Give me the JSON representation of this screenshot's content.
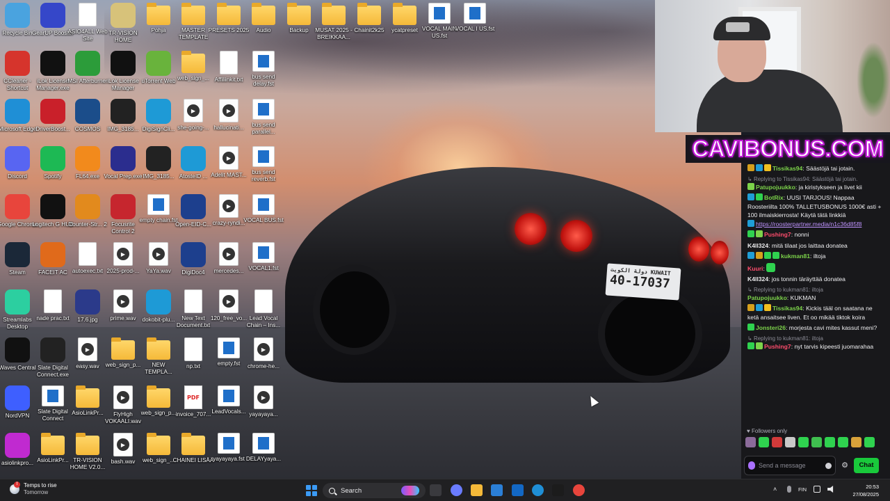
{
  "desktop": {
    "icons": [
      {
        "label": "Recycle Bin",
        "icon": "recycle-bin-icon",
        "kind": "app",
        "color": "#4aa3df"
      },
      {
        "label": "GearUP Booster",
        "icon": "gearup-icon",
        "kind": "app",
        "color": "#3547c9"
      },
      {
        "label": "ASIO4ALL Web Site",
        "icon": "document-icon",
        "kind": "doc"
      },
      {
        "label": "TR-VISION HOME",
        "icon": "tr-vision-icon",
        "kind": "app",
        "color": "#d7c27a"
      },
      {
        "label": "Pohja",
        "icon": "folder-icon",
        "kind": "folder"
      },
      {
        "label": "MASTER TEMPLATE",
        "icon": "folder-icon",
        "kind": "folder"
      },
      {
        "label": "PRESETS 2025",
        "icon": "folder-icon",
        "kind": "folder"
      },
      {
        "label": "Audio",
        "icon": "folder-icon",
        "kind": "folder"
      },
      {
        "label": "Backup",
        "icon": "folder-icon",
        "kind": "folder"
      },
      {
        "label": "MUSAT 2025 - BREIKKAA...",
        "icon": "folder-icon",
        "kind": "folder"
      },
      {
        "label": "Chainit2k25",
        "icon": "folder-icon",
        "kind": "folder"
      },
      {
        "label": "ycatpreset",
        "icon": "folder-icon",
        "kind": "folder"
      },
      {
        "label": "VOCAL MAIN US.fst",
        "icon": "fst-file-icon",
        "kind": "fst"
      },
      {
        "label": "VOCAL I US.fst",
        "icon": "fst-file-icon",
        "kind": "fst"
      },
      {
        "label": "CCleaner - Shortcut",
        "icon": "ccleaner-icon",
        "kind": "app",
        "color": "#d6342c"
      },
      {
        "label": "iLok License Manager.exe",
        "icon": "ilok-icon",
        "kind": "app",
        "color": "#111111"
      },
      {
        "label": "MSI Afterburner",
        "icon": "msi-afterburner-icon",
        "kind": "app",
        "color": "#2c9c3a"
      },
      {
        "label": "iLok License Manager",
        "icon": "ilok-icon",
        "kind": "app",
        "color": "#111111"
      },
      {
        "label": "uTorrent Web",
        "icon": "utorrent-icon",
        "kind": "app",
        "color": "#69b33c"
      },
      {
        "label": "web_sign_...",
        "icon": "folder-icon",
        "kind": "folder"
      },
      {
        "label": "Affiliinkit.txt",
        "icon": "text-file-icon",
        "kind": "doc"
      },
      {
        "label": "bus send delay.fst",
        "icon": "fst-file-icon",
        "kind": "fst"
      },
      {
        "label": "Microsoft Edge",
        "icon": "edge-icon",
        "kind": "app",
        "color": "#1f8fd6"
      },
      {
        "label": "DriverBoost...",
        "icon": "driver-booster-icon",
        "kind": "app",
        "color": "#c9202a"
      },
      {
        "label": "COSMOS",
        "icon": "cosmos-icon",
        "kind": "app",
        "color": "#1b4d8a"
      },
      {
        "label": "IMG_3185...",
        "icon": "image-file-icon",
        "kind": "app",
        "color": "#222222"
      },
      {
        "label": "DigiSignCli...",
        "icon": "digisign-icon",
        "kind": "app",
        "color": "#1e9ad6"
      },
      {
        "label": "she-going-...",
        "icon": "audio-file-icon",
        "kind": "wav"
      },
      {
        "label": "hallucinati...",
        "icon": "audio-file-icon",
        "kind": "wav"
      },
      {
        "label": "bus send parallel...",
        "icon": "fst-file-icon",
        "kind": "fst"
      },
      {
        "label": "Discord",
        "icon": "discord-icon",
        "kind": "app",
        "color": "#5865f2"
      },
      {
        "label": "Spotify",
        "icon": "spotify-icon",
        "kind": "app",
        "color": "#1db954"
      },
      {
        "label": "FL64.exe",
        "icon": "fl-studio-icon",
        "kind": "app",
        "color": "#f28a1c"
      },
      {
        "label": "Vocal Prep.exe",
        "icon": "vocal-prep-icon",
        "kind": "app",
        "color": "#2b2d8e"
      },
      {
        "label": "IMG_3185...",
        "icon": "image-file-icon",
        "kind": "app",
        "color": "#222222"
      },
      {
        "label": "AtosteID ...",
        "icon": "atoste-id-icon",
        "kind": "app",
        "color": "#1e9ad6"
      },
      {
        "label": "Adelit MAST...",
        "icon": "audio-file-icon",
        "kind": "wav"
      },
      {
        "label": "bus send reverb.fst",
        "icon": "fst-file-icon",
        "kind": "fst"
      },
      {
        "label": "Google Chrome",
        "icon": "chrome-icon",
        "kind": "app",
        "color": "#e8453c"
      },
      {
        "label": "Logitech G HUB",
        "icon": "logitech-icon",
        "kind": "app",
        "color": "#111111"
      },
      {
        "label": "Counter-Str... 2",
        "icon": "counter-strike-icon",
        "kind": "app",
        "color": "#e28a1d"
      },
      {
        "label": "Focusrite Control 2",
        "icon": "focusrite-icon",
        "kind": "app",
        "color": "#c6262e"
      },
      {
        "label": "empty chain.fst",
        "icon": "fst-file-icon",
        "kind": "fst"
      },
      {
        "label": "Open-EID-C...",
        "icon": "open-eid-icon",
        "kind": "app",
        "color": "#1d3f8d"
      },
      {
        "label": "crazy-ryndi...",
        "icon": "audio-file-icon",
        "kind": "wav"
      },
      {
        "label": "VOCAL BUS.fst",
        "icon": "fst-file-icon",
        "kind": "fst"
      },
      {
        "label": "Steam",
        "icon": "steam-icon",
        "kind": "app",
        "color": "#1b2838"
      },
      {
        "label": "FACEIT AC",
        "icon": "faceit-icon",
        "kind": "app",
        "color": "#e06a1b"
      },
      {
        "label": "autoexec.txt",
        "icon": "text-file-icon",
        "kind": "doc"
      },
      {
        "label": "2025-prod-...",
        "icon": "audio-file-icon",
        "kind": "wav"
      },
      {
        "label": "YaYa.wav",
        "icon": "audio-file-icon",
        "kind": "wav"
      },
      {
        "label": "DigiDoc4",
        "icon": "digidoc-icon",
        "kind": "app",
        "color": "#1d3f8d"
      },
      {
        "label": "mercedes...",
        "icon": "audio-file-icon",
        "kind": "wav"
      },
      {
        "label": "VOCAL1.fst",
        "icon": "fst-file-icon",
        "kind": "fst"
      },
      {
        "label": "Streamlabs Desktop",
        "icon": "streamlabs-icon",
        "kind": "app",
        "color": "#2ccfa0"
      },
      {
        "label": "nade prac.txt",
        "icon": "text-file-icon",
        "kind": "doc"
      },
      {
        "label": "17.6.jpg",
        "icon": "image-file-icon",
        "kind": "app",
        "color": "#2b3a8a"
      },
      {
        "label": "prime.wav",
        "icon": "audio-file-icon",
        "kind": "wav"
      },
      {
        "label": "dokobit-plu...",
        "icon": "dokobit-icon",
        "kind": "app",
        "color": "#1e9ad6"
      },
      {
        "label": "New Text Document.txt",
        "icon": "text-file-icon",
        "kind": "doc"
      },
      {
        "label": "120_free_vo...",
        "icon": "audio-file-icon",
        "kind": "wav"
      },
      {
        "label": "Lead Vocal Chain – Ins...",
        "icon": "text-file-icon",
        "kind": "doc"
      },
      {
        "label": "Waves Central",
        "icon": "waves-icon",
        "kind": "app",
        "color": "#111111"
      },
      {
        "label": "Slate Digital Connect.exe",
        "icon": "slate-digital-icon",
        "kind": "app",
        "color": "#222222"
      },
      {
        "label": "easy.wav",
        "icon": "audio-file-icon",
        "kind": "wav"
      },
      {
        "label": "web_sign_p...",
        "icon": "folder-icon",
        "kind": "folder"
      },
      {
        "label": "NEW TEMPLA...",
        "icon": "folder-icon",
        "kind": "folder"
      },
      {
        "label": "np.txt",
        "icon": "text-file-icon",
        "kind": "doc"
      },
      {
        "label": "empty.fst",
        "icon": "fst-file-icon",
        "kind": "fst"
      },
      {
        "label": "chrome-he...",
        "icon": "audio-file-icon",
        "kind": "wav"
      },
      {
        "label": "NordVPN",
        "icon": "nordvpn-icon",
        "kind": "app",
        "color": "#3e5fff"
      },
      {
        "label": "Slate Digital Connect",
        "icon": "slate-digital-icon",
        "kind": "fst"
      },
      {
        "label": "AsioLinkPr...",
        "icon": "folder-icon",
        "kind": "folder"
      },
      {
        "label": "FlyHigh VOKAALI.wav",
        "icon": "audio-file-icon",
        "kind": "wav"
      },
      {
        "label": "web_sign_p...",
        "icon": "folder-icon",
        "kind": "folder"
      },
      {
        "label": "invoice_707...",
        "icon": "pdf-file-icon",
        "kind": "pdf"
      },
      {
        "label": "LeadVocals...",
        "icon": "fst-file-icon",
        "kind": "fst"
      },
      {
        "label": "yayayaya...",
        "icon": "audio-file-icon",
        "kind": "wav"
      },
      {
        "label": "asiolinkpro...",
        "icon": "asiolink-icon",
        "kind": "app",
        "color": "#c02ad0"
      },
      {
        "label": "AsioLinkPr...",
        "icon": "folder-icon",
        "kind": "folder"
      },
      {
        "label": "TR-VISION HOME V2.0...",
        "icon": "folder-icon",
        "kind": "folder"
      },
      {
        "label": "bash.wav",
        "icon": "audio-file-icon",
        "kind": "wav"
      },
      {
        "label": "web_sign_...",
        "icon": "folder-icon",
        "kind": "folder"
      },
      {
        "label": "CHAINEI LISÄÄ",
        "icon": "folder-icon",
        "kind": "folder"
      },
      {
        "label": "yayayaya.fst",
        "icon": "fst-file-icon",
        "kind": "fst"
      },
      {
        "label": "DELAYyaya...",
        "icon": "fst-file-icon",
        "kind": "fst"
      }
    ]
  },
  "wallpaper": {
    "plate_line1": "دولة الكويت KUWAIT",
    "plate_line2": "40-17037"
  },
  "banner": {
    "text": "CAVIBONUS.COM",
    "accent_color": "#c21bd8"
  },
  "chat": {
    "messages": [
      {
        "reply_to": "",
        "badges": [
          "#d6a01c",
          "#1f9dd6",
          "#f0c020"
        ],
        "user": "Tissikas94",
        "user_color": "#7cd34a",
        "text": "Säästöjä tai jotain.",
        "link": ""
      },
      {
        "reply_to": "Replying to Tissikas94: Säästöjä tai jotain.",
        "badges": [
          "#7cd34a"
        ],
        "user": "Patupojuukko",
        "user_color": "#7cd34a",
        "text": "ja kiristykseen ja livet kii",
        "link": ""
      },
      {
        "reply_to": "",
        "badges": [
          "#1f9dd6",
          "#2fd24f"
        ],
        "user": "BotRix",
        "user_color": "#7cd34a",
        "text": "UUSI TARJOUS! Nappaa Roosteriilta 100% TALLETUSBONUS 1000€ asti + 100 ilmaiskierrosta! Käytä tätä linkkiä",
        "link": "https://roosterpartner.media/n1c36d85f8"
      },
      {
        "reply_to": "",
        "badges": [
          "#2fd24f",
          "#7cd34a"
        ],
        "user": "Pushing7",
        "user_color": "#ff4d6d",
        "text": "nonni",
        "link": ""
      },
      {
        "reply_to": "",
        "badges": [],
        "user": "K4ll324",
        "user_color": "#e8e8ea",
        "text": "mitä tilaat jos laittaa donatea",
        "link": ""
      },
      {
        "reply_to": "",
        "badges": [
          "#1f9dd6",
          "#d6a01c",
          "#2fd24f",
          "#2fd24f"
        ],
        "user": "kukman81",
        "user_color": "#7cd34a",
        "text": "iltoja",
        "link": ""
      },
      {
        "reply_to": "",
        "badges": [],
        "user": "Kuuri",
        "user_color": "#ff4d6d",
        "text": "",
        "link": "",
        "emote": true
      },
      {
        "reply_to": "",
        "badges": [],
        "user": "K4ll324",
        "user_color": "#e8e8ea",
        "text": "jos tonnin täräyttää donatea",
        "link": ""
      },
      {
        "reply_to": "Replying to kukman81: iltoja",
        "badges": [],
        "user": "Patupojuukko",
        "user_color": "#7cd34a",
        "text": "KUKMAN",
        "link": ""
      },
      {
        "reply_to": "",
        "badges": [
          "#d6a01c",
          "#1f9dd6",
          "#f0c020"
        ],
        "user": "Tissikas94",
        "user_color": "#7cd34a",
        "text": "Kickis tääl on saatana ne ketä ansaitsee liven. Et oo mikää tiktok koira",
        "link": ""
      },
      {
        "reply_to": "",
        "badges": [
          "#2fd24f"
        ],
        "user": "Jonsteri26",
        "user_color": "#7cd34a",
        "text": "morjesta cavi mites kassut meni?",
        "link": ""
      },
      {
        "reply_to": "Replying to kukman81: iltoja",
        "badges": [
          "#2fd24f",
          "#7cd34a"
        ],
        "user": "Pushing7",
        "user_color": "#ff4d6d",
        "text": "nyt tarvis kipeesti juomarahaa",
        "link": ""
      }
    ],
    "followers_only": "Followers only",
    "emote_colors": [
      "#8b6b9a",
      "#2fd24f",
      "#d23a3a",
      "#c9c9c9",
      "#2fd24f",
      "#3fbf4f",
      "#2fd24f",
      "#2fd24f",
      "#d8a23a",
      "#2fd24f"
    ],
    "input_placeholder": "Send a message",
    "chat_button": "Chat"
  },
  "taskbar": {
    "weather_title": "Temps to rise",
    "weather_sub": "Tomorrow",
    "search_label": "Search",
    "apps": [
      {
        "icon": "task-view-icon",
        "color": "#3a3a3e"
      },
      {
        "icon": "copilot-icon",
        "color": "#6a7cff"
      },
      {
        "icon": "file-explorer-icon",
        "color": "#f5b939"
      },
      {
        "icon": "microsoft-store-icon",
        "color": "#2b7fd6"
      },
      {
        "icon": "outlook-icon",
        "color": "#1368c4"
      },
      {
        "icon": "edge-icon",
        "color": "#1f8fd6"
      },
      {
        "icon": "kick-icon",
        "color": "#1c1c1c"
      },
      {
        "icon": "chrome-icon",
        "color": "#e8453c"
      }
    ],
    "language": "FIN",
    "time": "20:53",
    "date": "27/08/2025"
  }
}
